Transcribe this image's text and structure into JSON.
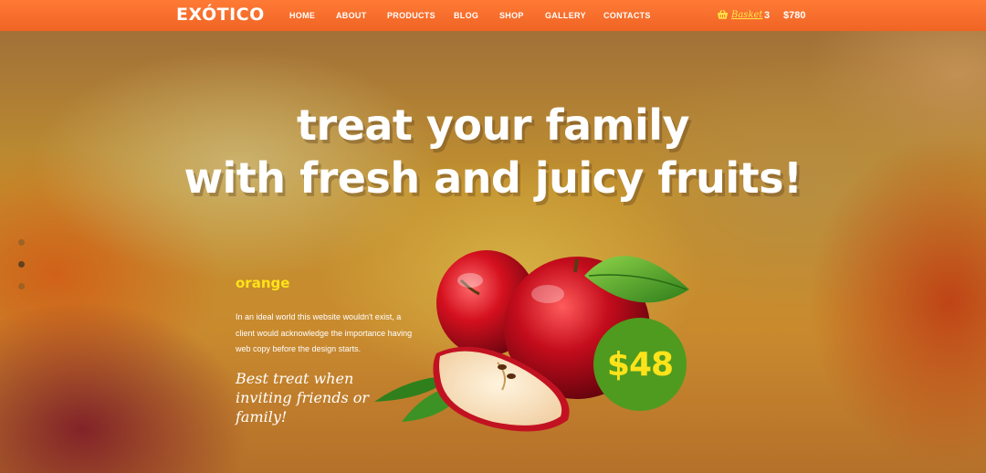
{
  "brand": {
    "logo": "EXÓTICO"
  },
  "nav": {
    "items": [
      "HOME",
      "ABOUT",
      "PRODUCTS",
      "BLOG",
      "SHOP",
      "GALLERY",
      "CONTACTS"
    ]
  },
  "basket": {
    "label": "Basket",
    "count": "3",
    "total": "$780",
    "icon": "basket-icon"
  },
  "hero": {
    "headline_line1": "treat your family",
    "headline_line2": "with fresh and juicy fruits!",
    "slides": 3,
    "active_slide": 2
  },
  "product": {
    "name": "orange",
    "description": "In an ideal world this website wouldn't exist, a client would acknowledge the importance having web copy before the design starts.",
    "tagline": "Best treat when inviting friends or family!",
    "price": "$48"
  },
  "colors": {
    "header": "#f06424",
    "accent_yellow": "#ffe31a",
    "price_badge": "#4e9b1f"
  }
}
